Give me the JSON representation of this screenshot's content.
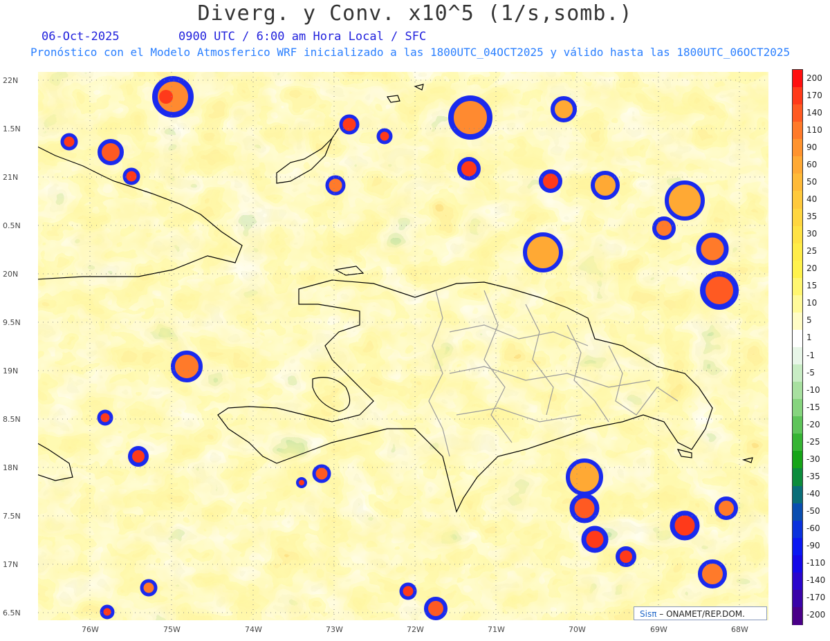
{
  "header": {
    "title": "Diverg. y Conv. x10^5 (1/s,somb.)",
    "date": "06-Oct-2025",
    "time_info": "0900 UTC / 6:00 am Hora Local / SFC",
    "forecast_info": "Pronóstico con el Modelo Atmosferico WRF inicializado a las 1800UTC_04OCT2025 y válido hasta las  1800UTC_06OCT2025"
  },
  "map": {
    "lat_labels": [
      "22N",
      "1.5N",
      "21N",
      "0.5N",
      "20N",
      "9.5N",
      "19N",
      "8.5N",
      "18N",
      "7.5N",
      "17N",
      "6.5N"
    ],
    "lon_labels": [
      "76W",
      "75W",
      "74W",
      "73W",
      "72W",
      "71W",
      "70W",
      "69W",
      "68W"
    ]
  },
  "legend": {
    "levels": [
      "200",
      "170",
      "140",
      "110",
      "90",
      "60",
      "50",
      "40",
      "35",
      "30",
      "25",
      "20",
      "15",
      "10",
      "5",
      "1",
      "-1",
      "-5",
      "-10",
      "-15",
      "-20",
      "-25",
      "-30",
      "-35",
      "-40",
      "-50",
      "-60",
      "-90",
      "-110",
      "-140",
      "-170",
      "-200"
    ],
    "colors": [
      "#ff1010",
      "#ff3a1a",
      "#ff5a22",
      "#ff7a2a",
      "#ff932e",
      "#ffa934",
      "#ffba38",
      "#ffc93c",
      "#ffd640",
      "#ffe244",
      "#ffec48",
      "#fff24c",
      "#fff670",
      "#fffa9a",
      "#fffcc6",
      "#ffffff",
      "#e8f6e8",
      "#c8ecc4",
      "#a8e0a0",
      "#86d47e",
      "#5ec45a",
      "#36b434",
      "#16a418",
      "#0c8c3c",
      "#0a6e78",
      "#0a4eb0",
      "#0a32dc",
      "#0a18f2",
      "#1408e8",
      "#2a06cc",
      "#3a04a8",
      "#4a0088"
    ]
  },
  "credit": {
    "brand": "Sisπ",
    "text": "– ONAMET/REP.DOM."
  }
}
